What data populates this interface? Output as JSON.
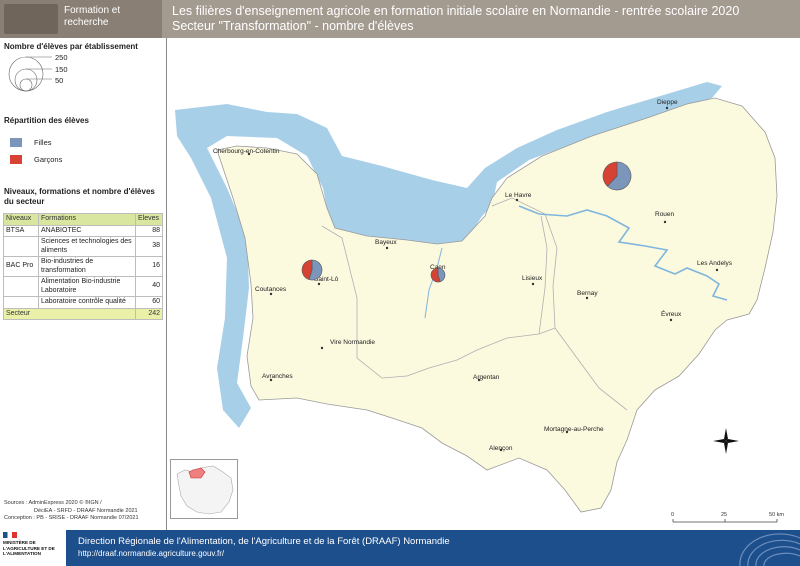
{
  "header": {
    "section": "Formation et recherche",
    "title_line1": "Les filières d'enseignement agricole en formation initiale scolaire en Normandie - rentrée scolaire 2020",
    "title_line2": "Secteur \"Transformation\" - nombre d'élèves"
  },
  "legend": {
    "size_title": "Nombre d'élèves par établissement",
    "size_values": [
      "250",
      "150",
      "50"
    ],
    "rep_title": "Répartition des élèves",
    "rep_items": [
      {
        "label": "Filles",
        "color": "#7b96ba"
      },
      {
        "label": "Garçons",
        "color": "#d64234"
      }
    ],
    "table_title": "Niveaux, formations et nombre d'élèves du secteur"
  },
  "table": {
    "headers": [
      "Niveaux",
      "Formations",
      "Eleves"
    ],
    "rows": [
      {
        "niveau": "BTSA",
        "formation": "ANABIOTEC",
        "eleves": "88"
      },
      {
        "niveau": "",
        "formation": "Sciences et technologies des aliments",
        "eleves": "38"
      },
      {
        "niveau": "BAC Pro",
        "formation": "Bio-industries de transformation",
        "eleves": "16"
      },
      {
        "niveau": "",
        "formation": "Alimentation Bio-industrie Laboratoire",
        "eleves": "40"
      },
      {
        "niveau": "",
        "formation": "Laboratoire contrôle qualité",
        "eleves": "60"
      }
    ],
    "total_label": "Secteur",
    "total_value": "242"
  },
  "sources": {
    "line1": "Sources     : AdminExpress 2020 © ®IGN /",
    "line2": "DéciEA - SRFD - DRAAF Normandie 2021",
    "line3": "Conception : PB - SRISE - DRAAF Normandie 07/2021"
  },
  "map": {
    "cities": [
      {
        "name": "Dieppe"
      },
      {
        "name": "Cherbourg-en-Cotentin"
      },
      {
        "name": "Le Havre"
      },
      {
        "name": "Rouen"
      },
      {
        "name": "Bayeux"
      },
      {
        "name": "Caen"
      },
      {
        "name": "Saint-Lô"
      },
      {
        "name": "Lisieux"
      },
      {
        "name": "Les Andelys"
      },
      {
        "name": "Coutances"
      },
      {
        "name": "Bernay"
      },
      {
        "name": "Évreux"
      },
      {
        "name": "Vire Normandie"
      },
      {
        "name": "Avranches"
      },
      {
        "name": "Argentan"
      },
      {
        "name": "Mortagne-au-Perche"
      },
      {
        "name": "Alençon"
      }
    ],
    "establishments": [
      {
        "location": "Neufchâtel-en-Bray area",
        "filles": 0.62,
        "garcons": 0.38,
        "size": "large"
      },
      {
        "location": "Saint-Lô",
        "filles": 0.55,
        "garcons": 0.45,
        "size": "medium"
      },
      {
        "location": "Caen",
        "filles": 0.45,
        "garcons": 0.55,
        "size": "small"
      }
    ],
    "scale": {
      "labels": [
        "0",
        "25",
        "50 km"
      ]
    },
    "colors": {
      "land": "#fbf9de",
      "sea": "#a8cfe8",
      "border": "#9a9a9a",
      "river": "#7fb6de"
    }
  },
  "footer": {
    "logo_text": "MINISTÈRE DE L'AGRICULTURE ET DE L'ALIMENTATION",
    "title": "Direction Régionale de l'Alimentation, de l'Agriculture et de la Forêt (DRAAF) Normandie",
    "url": "http://draaf.normandie.agriculture.gouv.fr/"
  }
}
